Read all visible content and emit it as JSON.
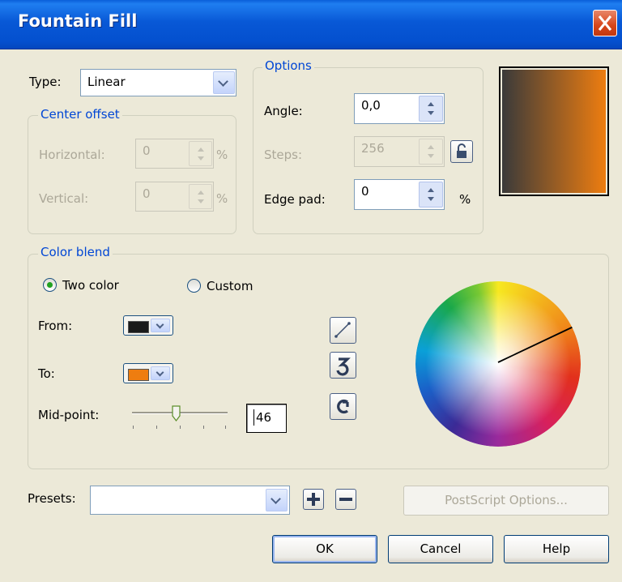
{
  "window": {
    "title": "Fountain Fill"
  },
  "type": {
    "label": "Type:",
    "value": "Linear"
  },
  "center_offset": {
    "legend": "Center offset",
    "horizontal": {
      "label": "Horizontal:",
      "value": "0",
      "unit": "%"
    },
    "vertical": {
      "label": "Vertical:",
      "value": "0",
      "unit": "%"
    }
  },
  "options": {
    "legend": "Options",
    "angle": {
      "label": "Angle:",
      "value": "0,0"
    },
    "steps": {
      "label": "Steps:",
      "value": "256"
    },
    "edge_pad": {
      "label": "Edge pad:",
      "value": "0",
      "unit": "%"
    }
  },
  "preview": {
    "gradient_from": "#3a3a3a",
    "gradient_to": "#ee7d10"
  },
  "color_blend": {
    "legend": "Color blend",
    "two_color": {
      "label": "Two color",
      "selected": true
    },
    "custom": {
      "label": "Custom",
      "selected": false
    },
    "from": {
      "label": "From:",
      "color": "#1a1a1a"
    },
    "to": {
      "label": "To:",
      "color": "#ee7d10"
    },
    "mid_point": {
      "label": "Mid-point:",
      "value": "46"
    },
    "wheel_icons": [
      "straight-line-icon",
      "counter-clockwise-icon",
      "clockwise-icon"
    ]
  },
  "presets": {
    "label": "Presets:",
    "value": ""
  },
  "buttons": {
    "postscript": "PostScript Options...",
    "ok": "OK",
    "cancel": "Cancel",
    "help": "Help"
  }
}
